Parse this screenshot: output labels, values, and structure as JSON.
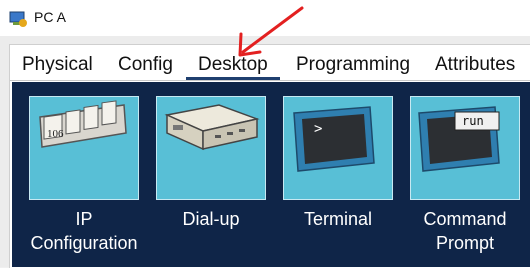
{
  "window": {
    "title": "PC A",
    "icon": "packet-tracer-pc-icon"
  },
  "tabs": [
    {
      "label": "Physical"
    },
    {
      "label": "Config"
    },
    {
      "label": "Desktop",
      "active": true
    },
    {
      "label": "Programming"
    },
    {
      "label": "Attributes"
    }
  ],
  "desktop": {
    "apps": [
      {
        "label": "IP Configuration",
        "icon": "ip-config-icon",
        "icon_text": "106"
      },
      {
        "label": "Dial-up",
        "icon": "modem-icon"
      },
      {
        "label": "Terminal",
        "icon": "terminal-icon",
        "icon_text": ">"
      },
      {
        "label": "Command Prompt",
        "icon": "command-prompt-icon",
        "icon_text": "run"
      }
    ]
  },
  "annotation": {
    "type": "red-arrow",
    "points_to": "Desktop tab",
    "color": "#e32020"
  },
  "colors": {
    "desktop_bg": "#0f2548",
    "tile_bg": "#58bfd6",
    "active_tab_underline": "#1f3f6f"
  }
}
